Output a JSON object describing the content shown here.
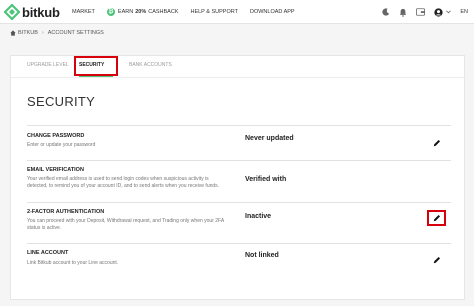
{
  "brand": {
    "name": "bitkub",
    "accent": "#4cc47a"
  },
  "nav": {
    "market": "MARKET",
    "cashback_pre": "EARN",
    "cashback_bold": "20%",
    "cashback_post": "CASHBACK",
    "help": "HELP & SUPPORT",
    "download": "DOWNLOAD APP"
  },
  "header_icons": [
    "moon-icon",
    "bell-icon",
    "wallet-icon",
    "user-icon",
    "chevron-down-icon"
  ],
  "language": "EN",
  "breadcrumb": {
    "home": "BITKUB",
    "current": "ACCOUNT SETTINGS"
  },
  "tabs": [
    {
      "label": "UPGRADE LEVEL"
    },
    {
      "label": "SECURITY"
    },
    {
      "label": "BANK ACCOUNTS"
    }
  ],
  "section_title": "SECURITY",
  "rows": [
    {
      "title": "CHANGE PASSWORD",
      "desc": "Enter or update your password",
      "status": "Never updated"
    },
    {
      "title": "EMAIL VERIFICATION",
      "desc": "Your verified email address is used to send login codes when suspicious activity is detected, to remind you of your account ID, and to send alerts when you receive funds.",
      "status": "Verified with"
    },
    {
      "title": "2-FACTOR AUTHENTICATION",
      "desc": "You can proceed with your Deposit, Withdrawal request, and Trading only when your 2FA status is active.",
      "status": "Inactive"
    },
    {
      "title": "LINE ACCOUNT",
      "desc": "Link Bitkub account to your Line account.",
      "status": "Not linked"
    }
  ]
}
